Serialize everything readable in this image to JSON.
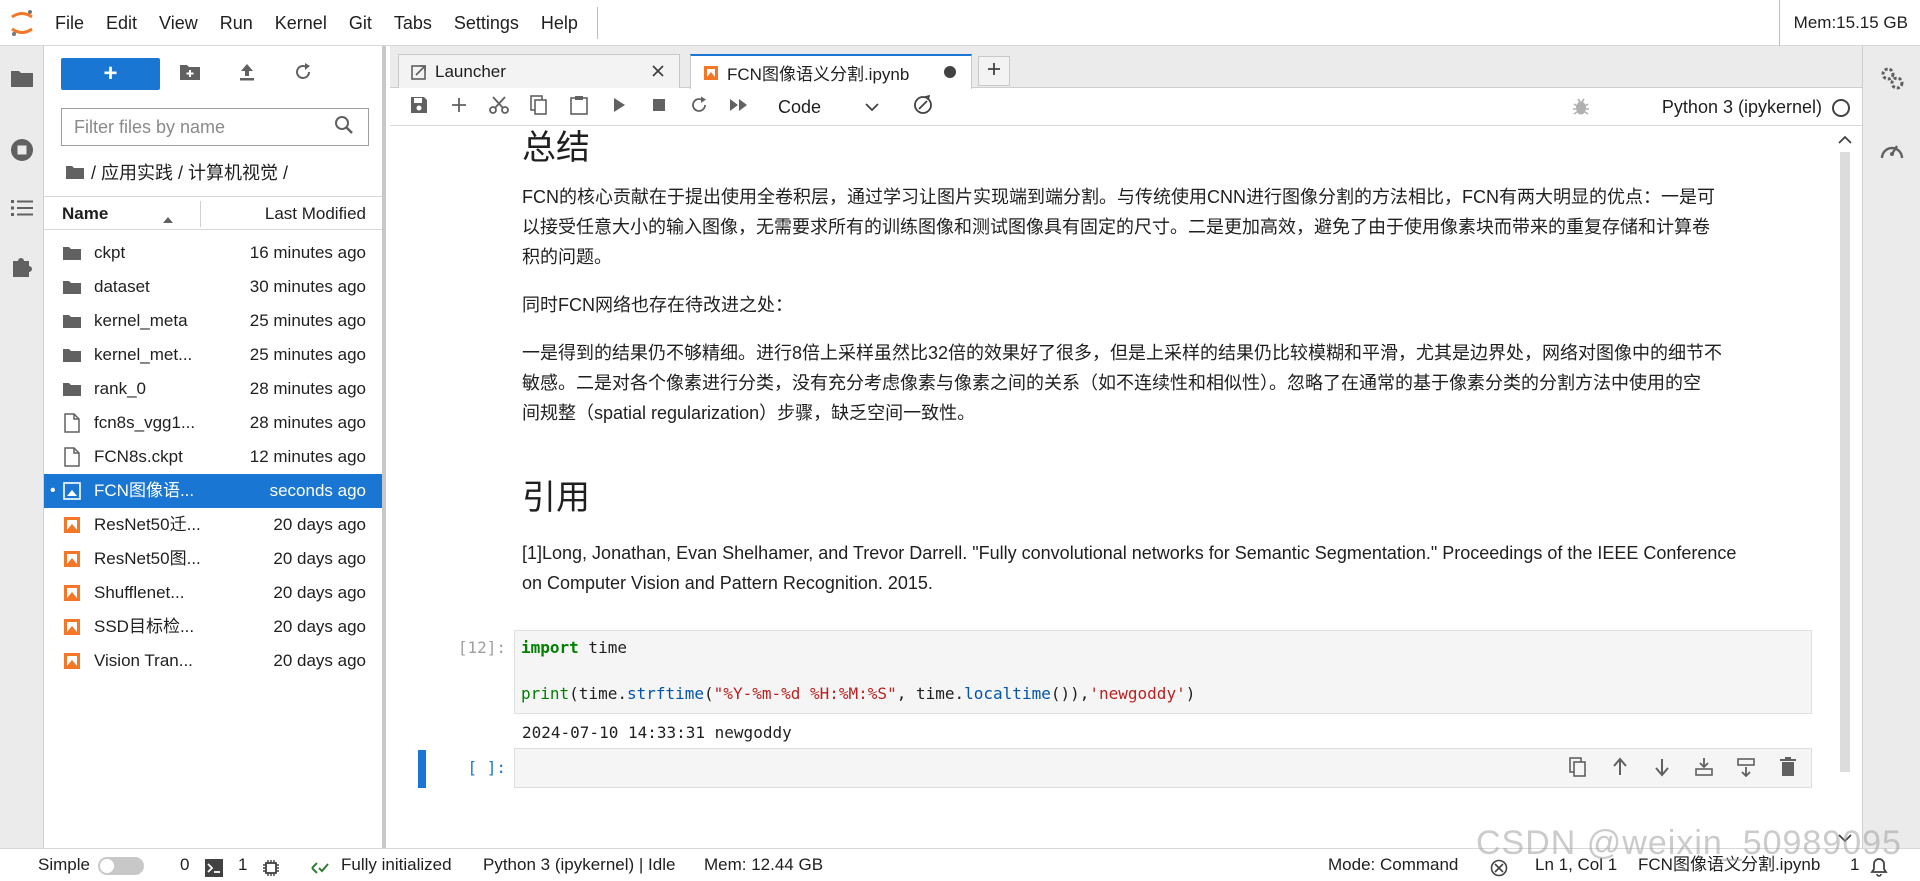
{
  "menubar": {
    "items": [
      "File",
      "Edit",
      "View",
      "Run",
      "Kernel",
      "Git",
      "Tabs",
      "Settings",
      "Help"
    ],
    "memory": "Mem:15.15 GB"
  },
  "filebrowser": {
    "new_label": "+",
    "filter_placeholder": "Filter files by name",
    "breadcrumb": "/ 应用实践 / 计算机视觉 /",
    "header_name": "Name",
    "header_modified": "Last Modified",
    "files": [
      {
        "name": "ckpt",
        "modified": "16 minutes ago",
        "icon": "folder-icon"
      },
      {
        "name": "dataset",
        "modified": "30 minutes ago",
        "icon": "folder-icon"
      },
      {
        "name": "kernel_meta",
        "modified": "25 minutes ago",
        "icon": "folder-icon"
      },
      {
        "name": "kernel_met...",
        "modified": "25 minutes ago",
        "icon": "folder-icon"
      },
      {
        "name": "rank_0",
        "modified": "28 minutes ago",
        "icon": "folder-icon"
      },
      {
        "name": "fcn8s_vgg1...",
        "modified": "28 minutes ago",
        "icon": "file-icon"
      },
      {
        "name": "FCN8s.ckpt",
        "modified": "12 minutes ago",
        "icon": "file-icon"
      },
      {
        "name": "FCN图像语...",
        "modified": "seconds ago",
        "icon": "notebook-icon",
        "selected": true,
        "running_dot": "•"
      },
      {
        "name": "ResNet50迁...",
        "modified": "20 days ago",
        "icon": "notebook-icon"
      },
      {
        "name": "ResNet50图...",
        "modified": "20 days ago",
        "icon": "notebook-icon"
      },
      {
        "name": "Shufflenet...",
        "modified": "20 days ago",
        "icon": "notebook-icon"
      },
      {
        "name": "SSD目标检...",
        "modified": "20 days ago",
        "icon": "notebook-icon"
      },
      {
        "name": "Vision Tran...",
        "modified": "20 days ago",
        "icon": "notebook-icon"
      }
    ]
  },
  "tabs": {
    "launcher": "Launcher",
    "notebook": "FCN图像语义分割.ipynb",
    "add": "+"
  },
  "toolbar": {
    "cell_type": "Code",
    "kernel": "Python 3 (ipykernel)"
  },
  "notebook": {
    "summary_heading": "总结",
    "summary_p1_l1": "FCN的核心贡献在于提出使用全卷积层，通过学习让图片实现端到端分割。与传统使用CNN进行图像分割的方法相比，FCN有两大明显的优点：一是可",
    "summary_p1_l2": "以接受任意大小的输入图像，无需要求所有的训练图像和测试图像具有固定的尺寸。二是更加高效，避免了由于使用像素块而带来的重复存储和计算卷",
    "summary_p1_l3": "积的问题。",
    "summary_p2": "同时FCN网络也存在待改进之处：",
    "summary_p3_l1": "一是得到的结果仍不够精细。进行8倍上采样虽然比32倍的效果好了很多，但是上采样的结果仍比较模糊和平滑，尤其是边界处，网络对图像中的细节不",
    "summary_p3_l2": "敏感。二是对各个像素进行分类，没有充分考虑像素与像素之间的关系（如不连续性和相似性）。忽略了在通常的基于像素分类的分割方法中使用的空",
    "summary_p3_l3": "间规整（spatial regularization）步骤，缺乏空间一致性。",
    "ref_heading": "引用",
    "ref_l1": "[1]Long, Jonathan, Evan Shelhamer, and Trevor Darrell. \"Fully convolutional networks for Semantic Segmentation.\" Proceedings of the IEEE Conference",
    "ref_l2": "on Computer Vision and Pattern Recognition. 2015.",
    "code_prompt": "[12]:",
    "code_kw_import": "import",
    "code_mod_time": " time",
    "code_print": "print",
    "code_arg1": "(time.",
    "code_strftime": "strftime",
    "code_paren": "(",
    "code_fmt": "\"%Y-%m-%d %H:%M:%S\"",
    "code_comma": ", time.",
    "code_localtime": "localtime",
    "code_close": "()),",
    "code_str2": "'newgoddy'",
    "code_end": ")",
    "output": "2024-07-10 14:33:31 newgoddy",
    "empty_prompt": "[ ]:"
  },
  "statusbar": {
    "mode_label": "Simple",
    "terminals_count": "0",
    "kernels_count": "1",
    "init_status": "Fully initialized",
    "kernel_status": "Python 3 (ipykernel) | Idle",
    "mem": "Mem: 12.44 GB",
    "command_mode": "Mode: Command",
    "cursor": "Ln 1, Col 1",
    "filename": "FCN图像语义分割.ipynb",
    "notifications": "1"
  },
  "watermark": "CSDN @weixin_50989095"
}
